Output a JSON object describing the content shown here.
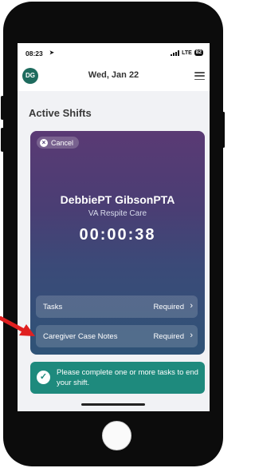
{
  "status_bar": {
    "time": "08:23",
    "network": "LTE",
    "battery": "82"
  },
  "app_bar": {
    "avatar_initials": "DG",
    "date": "Wed, Jan 22"
  },
  "section_title": "Active Shifts",
  "shift": {
    "cancel_label": "Cancel",
    "caregiver_name": "DebbiePT GibsonPTA",
    "organization": "VA Respite Care",
    "timer": "00:00:38",
    "tasks": [
      {
        "label": "Tasks",
        "status": "Required"
      },
      {
        "label": "Caregiver Case Notes",
        "status": "Required"
      }
    ]
  },
  "notice": {
    "text": "Please complete one or more tasks to end your shift."
  },
  "colors": {
    "card_top": "#5a3a74",
    "card_bottom": "#2f5377",
    "accent_teal": "#1e8a7d",
    "avatar": "#1e6b5e",
    "annotation_arrow": "#e02020"
  }
}
